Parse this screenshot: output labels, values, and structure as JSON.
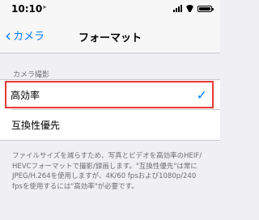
{
  "status_bar": {
    "time": "10:10",
    "battery_level": 1.0
  },
  "nav": {
    "back_label": "カメラ",
    "title": "フォーマット"
  },
  "section": {
    "header": "カメラ撮影"
  },
  "options": [
    {
      "label": "高効率",
      "selected": true
    },
    {
      "label": "互換性優先",
      "selected": false
    }
  ],
  "footer": {
    "lines": [
      "ファイルサイズを減らすため、写真とビデオを高効率のHEIF/",
      "HEVCフォーマットで撮影/録画します。\"互換性優先\"は常に",
      "JPEG/H.264を使用しますが、4K/60 fpsおよび1080p/240",
      "fpsを使用するには\"高効率\"が必要です。"
    ]
  },
  "colors": {
    "accent": "#007aff",
    "highlight": "#e53935",
    "background": "#efeff4"
  }
}
